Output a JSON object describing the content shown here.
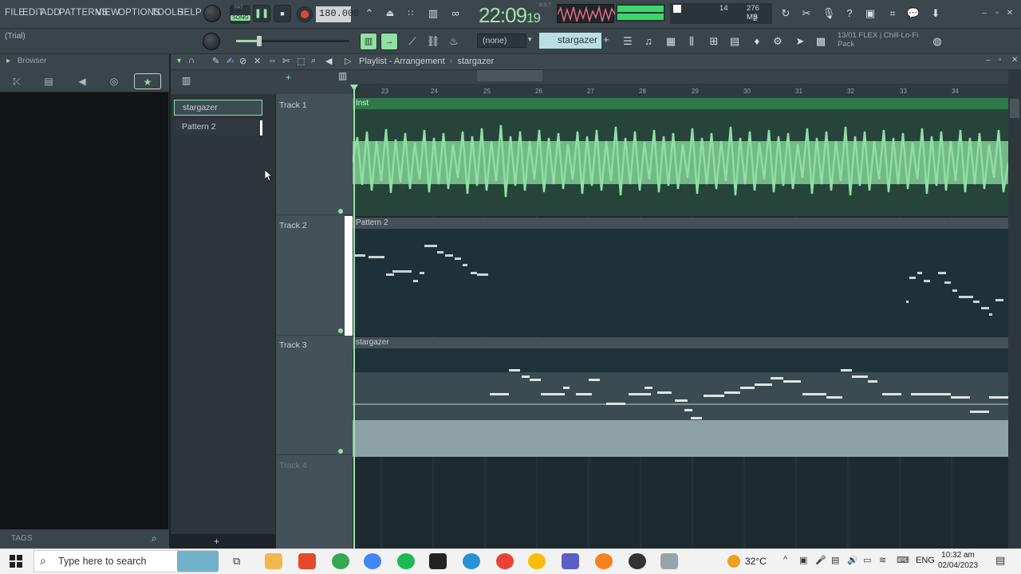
{
  "menu": [
    "FILE",
    "EDIT",
    "ADD",
    "PATTERNS",
    "VIEW",
    "OPTIONS",
    "TOOLS",
    "HELP"
  ],
  "transport": {
    "pat_label": "PAT",
    "song_label": "SONG",
    "bpm": "180.000",
    "time_main": "22:09",
    "time_sec": "19",
    "time_sig": "B:S:T"
  },
  "meters": {
    "cpu": "14",
    "memory": "276 MB",
    "voices": "2"
  },
  "hint": "(Trial)",
  "toolbar2": {
    "pattern_select": "(none)",
    "pattern_name": "stargazer",
    "pack_line1": "13/01  FLEX | Chill-Lo-Fi",
    "pack_line2": "Pack"
  },
  "browser": {
    "title": "Browser",
    "tags_label": "TAGS"
  },
  "playlist": {
    "title": "Playlist - Arrangement",
    "title_sep": "›",
    "current_pattern": "stargazer"
  },
  "picker": [
    {
      "label": "stargazer"
    },
    {
      "label": "Pattern 2"
    }
  ],
  "tracks": [
    {
      "label": "Track 1",
      "clip": "Inst"
    },
    {
      "label": "Track 2",
      "clip": "Pattern 2"
    },
    {
      "label": "Track 3",
      "clip": "stargazer"
    },
    {
      "label": "Track 4",
      "clip": ""
    }
  ],
  "ruler": [
    "23",
    "24",
    "25",
    "26",
    "27",
    "28",
    "29",
    "30",
    "31",
    "32",
    "33",
    "34"
  ],
  "taskbar": {
    "search_placeholder": "Type here to search",
    "temperature": "32°C",
    "language": "ENG",
    "time": "10:32 am",
    "date": "02/04/2023"
  },
  "colors": {
    "audio_clip": "#8fe0a3",
    "pattern_clip": "#445158",
    "accent": "#9ee3a7"
  }
}
